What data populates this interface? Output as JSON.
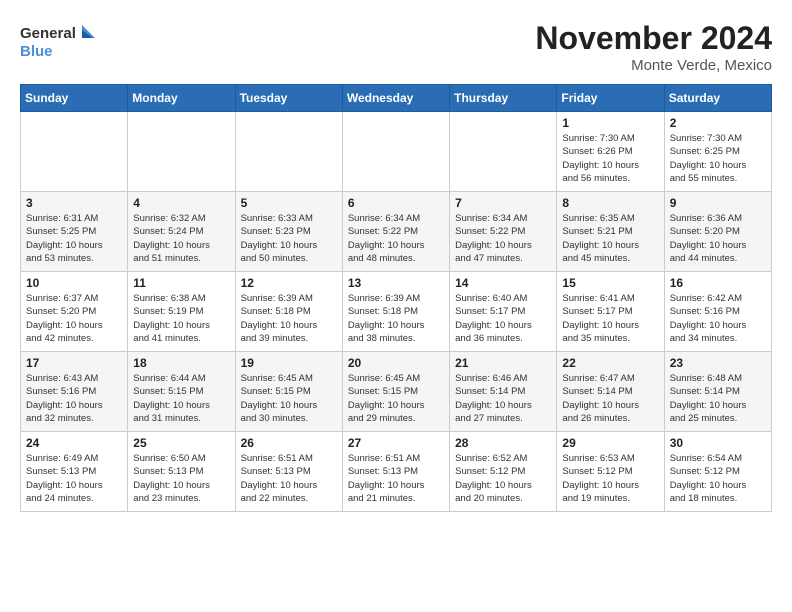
{
  "logo": {
    "line1": "General",
    "line2": "Blue"
  },
  "title": "November 2024",
  "location": "Monte Verde, Mexico",
  "days_of_week": [
    "Sunday",
    "Monday",
    "Tuesday",
    "Wednesday",
    "Thursday",
    "Friday",
    "Saturday"
  ],
  "weeks": [
    [
      {
        "day": "",
        "info": ""
      },
      {
        "day": "",
        "info": ""
      },
      {
        "day": "",
        "info": ""
      },
      {
        "day": "",
        "info": ""
      },
      {
        "day": "",
        "info": ""
      },
      {
        "day": "1",
        "info": "Sunrise: 7:30 AM\nSunset: 6:26 PM\nDaylight: 10 hours\nand 56 minutes."
      },
      {
        "day": "2",
        "info": "Sunrise: 7:30 AM\nSunset: 6:25 PM\nDaylight: 10 hours\nand 55 minutes."
      }
    ],
    [
      {
        "day": "3",
        "info": "Sunrise: 6:31 AM\nSunset: 5:25 PM\nDaylight: 10 hours\nand 53 minutes."
      },
      {
        "day": "4",
        "info": "Sunrise: 6:32 AM\nSunset: 5:24 PM\nDaylight: 10 hours\nand 51 minutes."
      },
      {
        "day": "5",
        "info": "Sunrise: 6:33 AM\nSunset: 5:23 PM\nDaylight: 10 hours\nand 50 minutes."
      },
      {
        "day": "6",
        "info": "Sunrise: 6:34 AM\nSunset: 5:22 PM\nDaylight: 10 hours\nand 48 minutes."
      },
      {
        "day": "7",
        "info": "Sunrise: 6:34 AM\nSunset: 5:22 PM\nDaylight: 10 hours\nand 47 minutes."
      },
      {
        "day": "8",
        "info": "Sunrise: 6:35 AM\nSunset: 5:21 PM\nDaylight: 10 hours\nand 45 minutes."
      },
      {
        "day": "9",
        "info": "Sunrise: 6:36 AM\nSunset: 5:20 PM\nDaylight: 10 hours\nand 44 minutes."
      }
    ],
    [
      {
        "day": "10",
        "info": "Sunrise: 6:37 AM\nSunset: 5:20 PM\nDaylight: 10 hours\nand 42 minutes."
      },
      {
        "day": "11",
        "info": "Sunrise: 6:38 AM\nSunset: 5:19 PM\nDaylight: 10 hours\nand 41 minutes."
      },
      {
        "day": "12",
        "info": "Sunrise: 6:39 AM\nSunset: 5:18 PM\nDaylight: 10 hours\nand 39 minutes."
      },
      {
        "day": "13",
        "info": "Sunrise: 6:39 AM\nSunset: 5:18 PM\nDaylight: 10 hours\nand 38 minutes."
      },
      {
        "day": "14",
        "info": "Sunrise: 6:40 AM\nSunset: 5:17 PM\nDaylight: 10 hours\nand 36 minutes."
      },
      {
        "day": "15",
        "info": "Sunrise: 6:41 AM\nSunset: 5:17 PM\nDaylight: 10 hours\nand 35 minutes."
      },
      {
        "day": "16",
        "info": "Sunrise: 6:42 AM\nSunset: 5:16 PM\nDaylight: 10 hours\nand 34 minutes."
      }
    ],
    [
      {
        "day": "17",
        "info": "Sunrise: 6:43 AM\nSunset: 5:16 PM\nDaylight: 10 hours\nand 32 minutes."
      },
      {
        "day": "18",
        "info": "Sunrise: 6:44 AM\nSunset: 5:15 PM\nDaylight: 10 hours\nand 31 minutes."
      },
      {
        "day": "19",
        "info": "Sunrise: 6:45 AM\nSunset: 5:15 PM\nDaylight: 10 hours\nand 30 minutes."
      },
      {
        "day": "20",
        "info": "Sunrise: 6:45 AM\nSunset: 5:15 PM\nDaylight: 10 hours\nand 29 minutes."
      },
      {
        "day": "21",
        "info": "Sunrise: 6:46 AM\nSunset: 5:14 PM\nDaylight: 10 hours\nand 27 minutes."
      },
      {
        "day": "22",
        "info": "Sunrise: 6:47 AM\nSunset: 5:14 PM\nDaylight: 10 hours\nand 26 minutes."
      },
      {
        "day": "23",
        "info": "Sunrise: 6:48 AM\nSunset: 5:14 PM\nDaylight: 10 hours\nand 25 minutes."
      }
    ],
    [
      {
        "day": "24",
        "info": "Sunrise: 6:49 AM\nSunset: 5:13 PM\nDaylight: 10 hours\nand 24 minutes."
      },
      {
        "day": "25",
        "info": "Sunrise: 6:50 AM\nSunset: 5:13 PM\nDaylight: 10 hours\nand 23 minutes."
      },
      {
        "day": "26",
        "info": "Sunrise: 6:51 AM\nSunset: 5:13 PM\nDaylight: 10 hours\nand 22 minutes."
      },
      {
        "day": "27",
        "info": "Sunrise: 6:51 AM\nSunset: 5:13 PM\nDaylight: 10 hours\nand 21 minutes."
      },
      {
        "day": "28",
        "info": "Sunrise: 6:52 AM\nSunset: 5:12 PM\nDaylight: 10 hours\nand 20 minutes."
      },
      {
        "day": "29",
        "info": "Sunrise: 6:53 AM\nSunset: 5:12 PM\nDaylight: 10 hours\nand 19 minutes."
      },
      {
        "day": "30",
        "info": "Sunrise: 6:54 AM\nSunset: 5:12 PM\nDaylight: 10 hours\nand 18 minutes."
      }
    ]
  ]
}
